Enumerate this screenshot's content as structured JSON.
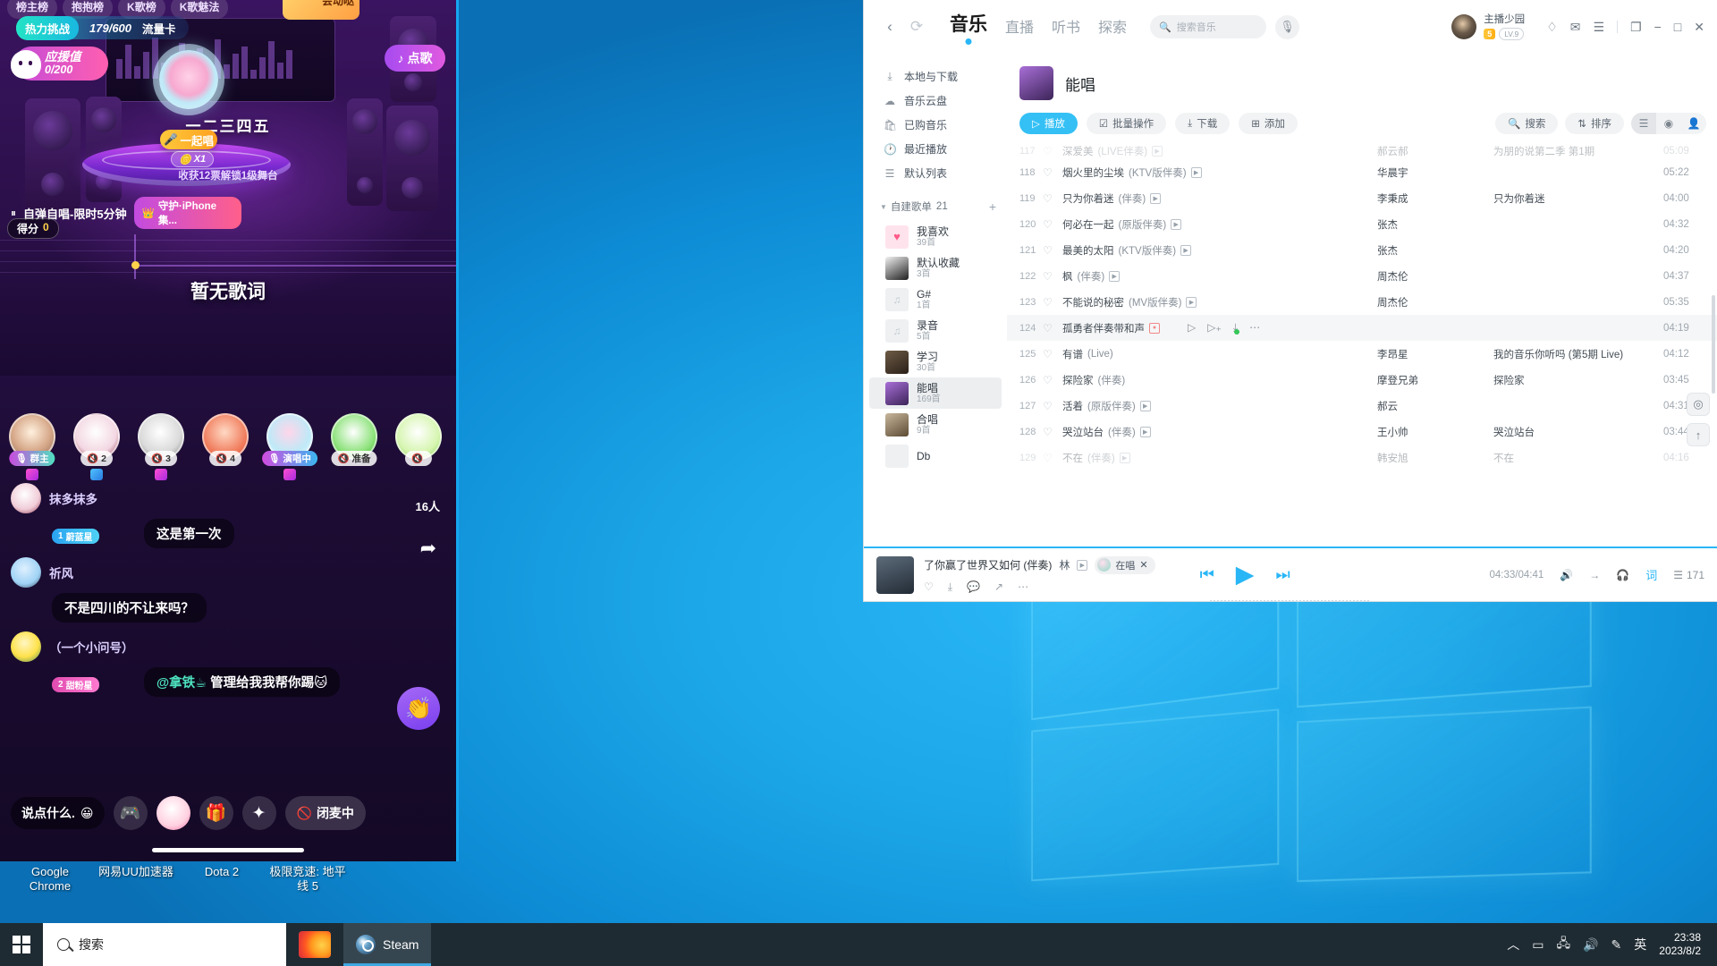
{
  "desktop": {
    "icons": [
      {
        "label": "Google Chrome"
      },
      {
        "label": "网易UU加速器"
      },
      {
        "label": "Dota 2"
      },
      {
        "label": "极限竞速: 地平线 5"
      }
    ]
  },
  "taskbar": {
    "search_placeholder": "搜索",
    "apps": [
      {
        "label": "Steam"
      }
    ],
    "tray": {
      "lang": "英",
      "time": "23:38",
      "date": "2023/8/2"
    }
  },
  "ktv": {
    "rank_pills": [
      "榜主榜",
      "抱抱榜",
      "K歌榜",
      "K歌魅法"
    ],
    "ad_label": "会动哒",
    "hot": {
      "tag": "热力挑战",
      "value": "179/600",
      "card": "流量卡"
    },
    "support": {
      "label": "应援值",
      "value": "0/200"
    },
    "song_button": "点歌",
    "singer_name": "一二三四五",
    "sing_button": "一起唱",
    "multiplier": "X1",
    "unlock_text": "收获12票解锁1级舞台",
    "mode_label": "自弹自唱-限时5分钟",
    "guard_label": "守护·iPhone集...",
    "score_label": "得分",
    "score_value": "0",
    "no_lyric": "暂无歌词",
    "people_count": "16人",
    "seats": [
      {
        "badge": "群主",
        "type": "owner"
      },
      {
        "badge": "2",
        "type": "plain"
      },
      {
        "badge": "3",
        "type": "plain"
      },
      {
        "badge": "4",
        "type": "plain"
      },
      {
        "badge": "演唱中",
        "type": "singing"
      },
      {
        "badge": "准备",
        "type": "plain"
      },
      {
        "badge": "",
        "type": "plain"
      }
    ],
    "chat": [
      {
        "name": "抹多抹多",
        "level": "蔚蓝星",
        "level_num": "1",
        "text": "这是第一次"
      },
      {
        "name": "祈风",
        "level": "",
        "level_num": "",
        "text": "不是四川的不让来吗？"
      },
      {
        "name": "（一个小问号）",
        "level": "甜粉星",
        "level_num": "2",
        "text": "@拿铁☕ 管理给我我帮你踢🐱",
        "mention": "@拿铁☕",
        "rest": " 管理给我我帮你踢🐱"
      }
    ],
    "input_placeholder": "说点什么.",
    "mute_label": "闭麦中"
  },
  "music": {
    "nav": {
      "back_icon": "chevron-left",
      "refresh_icon": "refresh"
    },
    "tabs": [
      {
        "label": "音乐",
        "active": true
      },
      {
        "label": "直播",
        "active": false
      },
      {
        "label": "听书",
        "active": false
      },
      {
        "label": "探索",
        "active": false
      }
    ],
    "search_placeholder": "搜索音乐",
    "user": {
      "name": "主播少园",
      "level_badge": "5",
      "level_text": "LV.9"
    },
    "sidebar": {
      "items": [
        {
          "label": "本地与下载",
          "icon": "download-icon"
        },
        {
          "label": "音乐云盘",
          "icon": "cloud-icon"
        },
        {
          "label": "已购音乐",
          "icon": "bag-icon"
        },
        {
          "label": "最近播放",
          "icon": "clock-icon"
        },
        {
          "label": "默认列表",
          "icon": "list-icon"
        }
      ],
      "section_title": "自建歌单",
      "section_count": "21",
      "playlists": [
        {
          "name": "我喜欢",
          "count": "39首",
          "active": false
        },
        {
          "name": "默认收藏",
          "count": "3首",
          "active": false
        },
        {
          "name": "G#",
          "count": "1首",
          "active": false
        },
        {
          "name": "录音",
          "count": "5首",
          "active": false
        },
        {
          "name": "学习",
          "count": "30首",
          "active": false
        },
        {
          "name": "能唱",
          "count": "169首",
          "active": true
        },
        {
          "name": "合唱",
          "count": "9首",
          "active": false
        },
        {
          "name": "Db",
          "count": "",
          "active": false
        }
      ]
    },
    "playlist": {
      "title": "能唱",
      "actions": [
        {
          "label": "播放",
          "icon": "play-icon",
          "primary": true
        },
        {
          "label": "批量操作",
          "icon": "check-icon",
          "primary": false
        },
        {
          "label": "下载",
          "icon": "download-icon",
          "primary": false
        },
        {
          "label": "添加",
          "icon": "plus-icon",
          "primary": false
        }
      ],
      "right_actions": [
        {
          "label": "搜索",
          "icon": "search-icon"
        },
        {
          "label": "排序",
          "icon": "sort-icon"
        }
      ]
    },
    "tracks": [
      {
        "index": "117",
        "name": "深爱美",
        "sub": "(LIVE伴奏)",
        "mv": true,
        "artist": "郝云郝",
        "album": "为朋的说第二季 第1期",
        "duration": "05:09",
        "partial": true
      },
      {
        "index": "118",
        "name": "烟火里的尘埃",
        "sub": "(KTV版伴奏)",
        "mv": true,
        "artist": "华晨宇",
        "album": "",
        "duration": "05:22"
      },
      {
        "index": "119",
        "name": "只为你着迷",
        "sub": "(伴奏)",
        "mv": true,
        "artist": "李秉成",
        "album": "只为你着迷",
        "duration": "04:00"
      },
      {
        "index": "120",
        "name": "何必在一起",
        "sub": "(原版伴奏)",
        "mv": true,
        "artist": "张杰",
        "album": "",
        "duration": "04:32"
      },
      {
        "index": "121",
        "name": "最美的太阳",
        "sub": "(KTV版伴奏)",
        "mv": true,
        "artist": "张杰",
        "album": "",
        "duration": "04:20"
      },
      {
        "index": "122",
        "name": "枫",
        "sub": "(伴奏)",
        "mv": true,
        "artist": "周杰伦",
        "album": "",
        "duration": "04:37"
      },
      {
        "index": "123",
        "name": "不能说的秘密",
        "sub": "(MV版伴奏)",
        "mv": true,
        "artist": "周杰伦",
        "album": "",
        "duration": "05:35"
      },
      {
        "index": "124",
        "name": "孤勇者伴奏带和声",
        "sub": "",
        "mv": true,
        "mv_red": true,
        "artist": "",
        "album": "",
        "duration": "04:19",
        "hover": true
      },
      {
        "index": "125",
        "name": "有谱",
        "sub": "(Live)",
        "mv": false,
        "artist": "李昂星",
        "album": "我的音乐你听吗 (第5期 Live)",
        "duration": "04:12"
      },
      {
        "index": "126",
        "name": "探险家",
        "sub": "(伴奏)",
        "mv": false,
        "artist": "摩登兄弟",
        "album": "探险家",
        "duration": "03:45"
      },
      {
        "index": "127",
        "name": "活着",
        "sub": "(原版伴奏)",
        "mv": true,
        "artist": "郝云",
        "album": "",
        "duration": "04:31"
      },
      {
        "index": "128",
        "name": "哭泣站台",
        "sub": "(伴奏)",
        "mv": true,
        "artist": "王小帅",
        "album": "哭泣站台",
        "duration": "03:44"
      },
      {
        "index": "129",
        "name": "不在",
        "sub": "(伴奏)",
        "mv": true,
        "artist": "韩安旭",
        "album": "不在",
        "duration": "04:16",
        "partial": true
      }
    ],
    "player": {
      "title": "了你赢了世界又如何 (伴奏)",
      "artist": "林",
      "sing_chip": "在唱",
      "time": "04:33/04:41",
      "queue_count": "171"
    }
  }
}
